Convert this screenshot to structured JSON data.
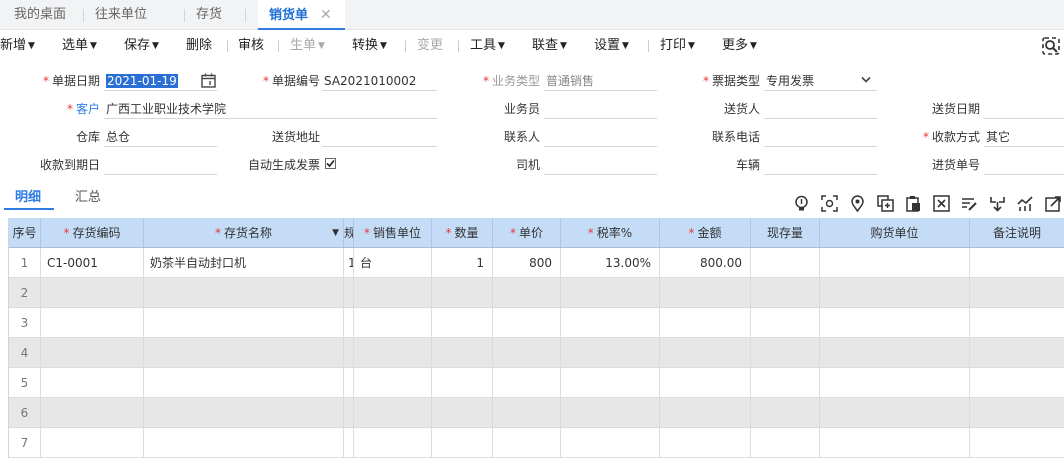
{
  "window_tabs": [
    {
      "label": "我的桌面"
    },
    {
      "label": "往来单位"
    },
    {
      "label": "存货"
    },
    {
      "label": "销货单",
      "close": "✕"
    }
  ],
  "toolbar": {
    "new": "新增",
    "select": "选单",
    "save": "保存",
    "delete": "删除",
    "audit": "审核",
    "generate": "生单",
    "convert": "转换",
    "change": "变更",
    "tools": "工具",
    "linked": "联查",
    "settings": "设置",
    "print": "打印",
    "more": "更多"
  },
  "form": {
    "date_label": "单据日期",
    "date_value": "2021-01-19",
    "number_label": "单据编号",
    "number_value": "SA2021010002",
    "biztype_label": "业务类型",
    "biztype_value": "普通销售",
    "invoice_label": "票据类型",
    "invoice_value": "专用发票",
    "customer_label": "客户",
    "customer_value": "广西工业职业技术学院",
    "salesman_label": "业务员",
    "salesman_value": "",
    "deliverer_label": "送货人",
    "deliverer_value": "",
    "delivery_date_label": "送货日期",
    "delivery_date_value": "",
    "warehouse_label": "仓库",
    "warehouse_value": "总仓",
    "address_label": "送货地址",
    "address_value": "",
    "contact_label": "联系人",
    "contact_value": "",
    "phone_label": "联系电话",
    "phone_value": "",
    "payment_label": "收款方式",
    "payment_value": "其它",
    "due_label": "收款到期日",
    "due_value": "",
    "autoinv_label": "自动生成发票",
    "driver_label": "司机",
    "driver_value": "",
    "vehicle_label": "车辆",
    "vehicle_value": "",
    "purchase_no_label": "进货单号",
    "purchase_no_value": ""
  },
  "subtabs": {
    "detail": "明细",
    "summary": "汇总"
  },
  "grid": {
    "columns": [
      "序号",
      "存货编码",
      "存货名称",
      "规",
      "销售单位",
      "数量",
      "单价",
      "税率%",
      "金额",
      "现存量",
      "购货单位",
      "备注说明"
    ],
    "rows": [
      [
        "1",
        "C1-0001",
        "奶茶半自动封口机",
        "1",
        "台",
        "1",
        "800",
        "13.00%",
        "800.00",
        "",
        "",
        ""
      ],
      [
        "2",
        "",
        "",
        "",
        "",
        "",
        "",
        "",
        "",
        "",
        "",
        ""
      ],
      [
        "3",
        "",
        "",
        "",
        "",
        "",
        "",
        "",
        "",
        "",
        "",
        ""
      ],
      [
        "4",
        "",
        "",
        "",
        "",
        "",
        "",
        "",
        "",
        "",
        "",
        ""
      ],
      [
        "5",
        "",
        "",
        "",
        "",
        "",
        "",
        "",
        "",
        "",
        "",
        ""
      ],
      [
        "6",
        "",
        "",
        "",
        "",
        "",
        "",
        "",
        "",
        "",
        "",
        ""
      ],
      [
        "7",
        "",
        "",
        "",
        "",
        "",
        "",
        "",
        "",
        "",
        "",
        ""
      ]
    ]
  },
  "colors": {
    "accent": "#2f7be3",
    "required": "#e23c39",
    "header_bg": "#c5dcf7",
    "alt_row": "#e7e7e7"
  }
}
